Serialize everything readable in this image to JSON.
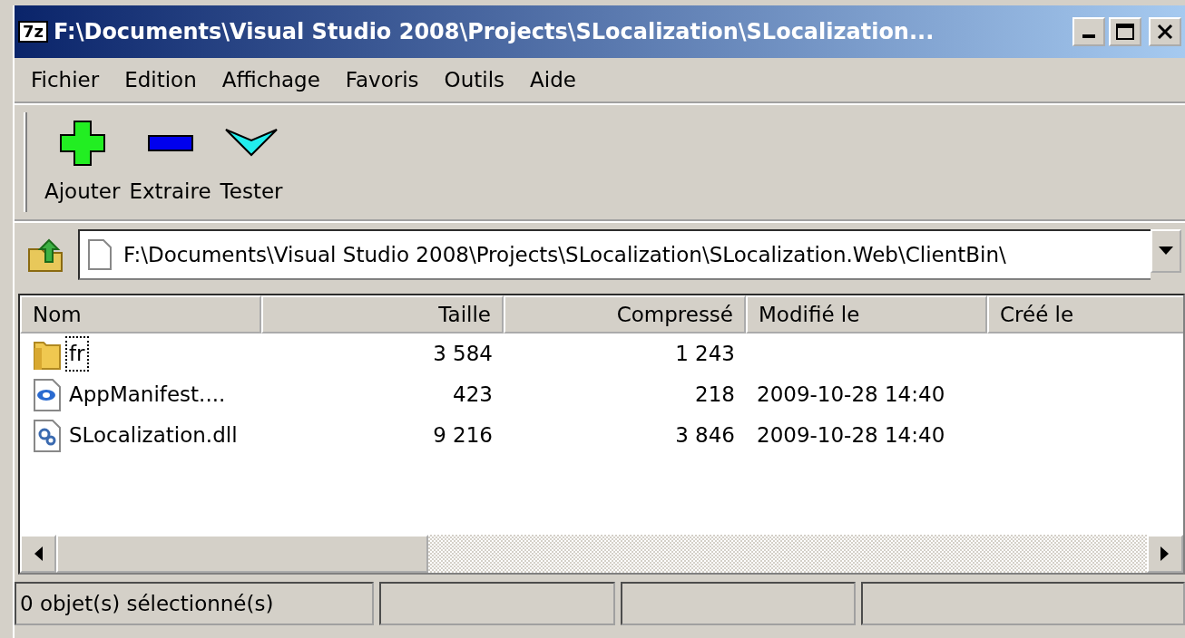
{
  "window": {
    "title": "F:\\Documents\\Visual Studio 2008\\Projects\\SLocalization\\SLocalization...",
    "app_badge": "7z"
  },
  "menu": [
    "Fichier",
    "Edition",
    "Affichage",
    "Favoris",
    "Outils",
    "Aide"
  ],
  "toolbar": [
    {
      "label": "Ajouter",
      "kind": "add"
    },
    {
      "label": "Extraire",
      "kind": "extract"
    },
    {
      "label": "Tester",
      "kind": "test"
    }
  ],
  "address": {
    "value": "F:\\Documents\\Visual Studio 2008\\Projects\\SLocalization\\SLocalization.Web\\ClientBin\\"
  },
  "table": {
    "columns": [
      "Nom",
      "Taille",
      "Compressé",
      "Modifié le",
      "Créé le"
    ],
    "rows": [
      {
        "kind": "folder",
        "name": "fr",
        "size": "3 584",
        "packed": "1 243",
        "focused": true
      },
      {
        "kind": "manifest",
        "name": "AppManifest....",
        "size": "423",
        "packed": "218",
        "modified": "2009-10-28 14:40",
        "focused": false
      },
      {
        "kind": "dll",
        "name": "SLocalization.dll",
        "size": "9 216",
        "packed": "3 846",
        "modified": "2009-10-28 14:40",
        "focused": false
      }
    ]
  },
  "status_bar": [
    "0 objet(s) sélectionné(s)"
  ]
}
